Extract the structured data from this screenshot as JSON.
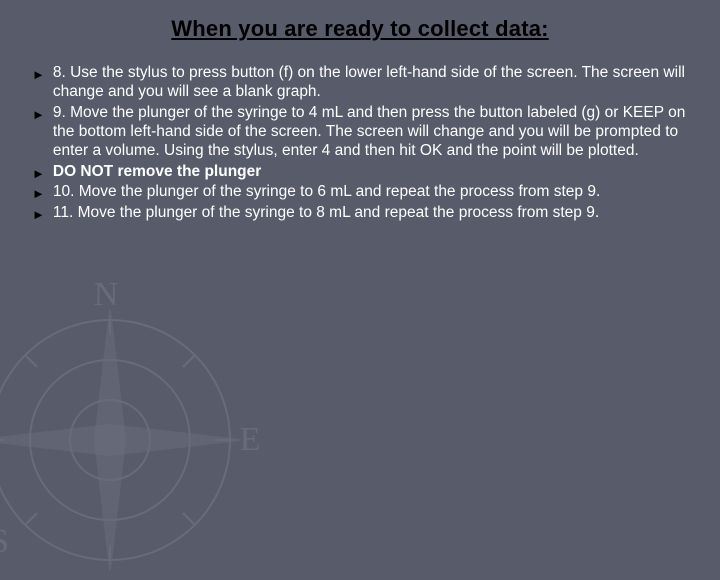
{
  "slide": {
    "title": "When you are ready to collect data:",
    "bullets": [
      {
        "text": "8.  Use the stylus to press button (f) on the lower left-hand side of the screen.  The screen will change and you will see a blank graph.",
        "bold": false
      },
      {
        "text": "9.  Move the plunger of the syringe to 4 mL and then press the button labeled (g) or KEEP on the bottom left-hand side of the screen.  The screen will change and you will be prompted to enter a volume.  Using the stylus, enter 4 and then hit OK and the point will be plotted.",
        "bold": false
      },
      {
        "text": "DO NOT remove the plunger",
        "bold": true
      },
      {
        "text": "10.  Move the plunger of the syringe to 6 mL and repeat the process from step 9.",
        "bold": false
      },
      {
        "text": "11.  Move the plunger of the syringe to 8 mL and repeat the process from step 9.",
        "bold": false
      }
    ]
  }
}
